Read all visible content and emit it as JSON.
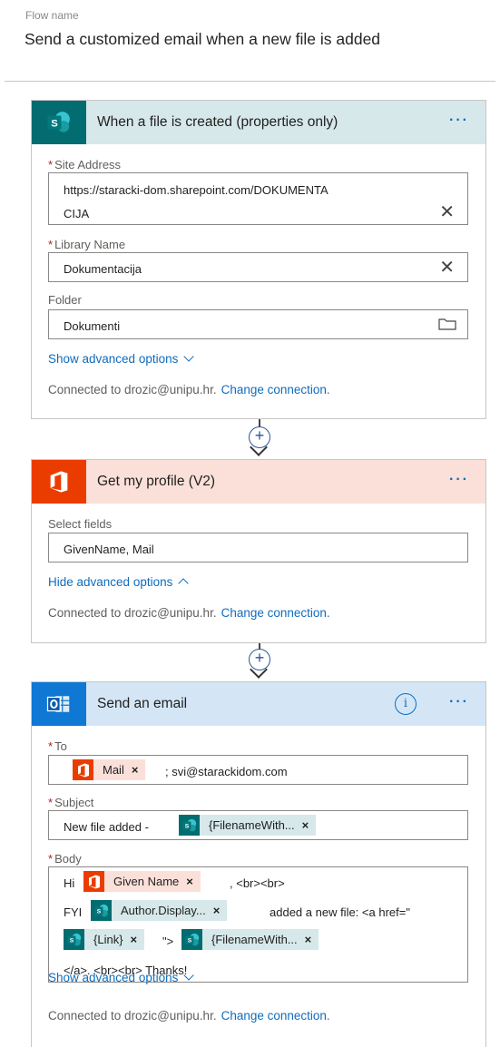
{
  "flow": {
    "name_label": "Flow name",
    "name": "Send a customized email when a new file is added"
  },
  "trigger": {
    "title": "When a file is created (properties only)",
    "more": "···",
    "site_address_label": "Site Address",
    "site_address_line1": "https://staracki-dom.sharepoint.com/DOKUMENTA",
    "site_address_line2": "CIJA",
    "library_label": "Library Name",
    "library_value": "Dokumentacija",
    "folder_label": "Folder",
    "folder_value": "Dokumenti",
    "show_advanced": "Show advanced options",
    "connected_to": "Connected to drozic@unipu.hr.",
    "change_connection": "Change connection."
  },
  "profile": {
    "title": "Get my profile (V2)",
    "more": "···",
    "select_fields_label": "Select fields",
    "select_fields_value": "GivenName, Mail",
    "hide_advanced": "Hide advanced options",
    "connected_to": "Connected to drozic@unipu.hr.",
    "change_connection": "Change connection."
  },
  "email": {
    "title": "Send an email",
    "info": "i",
    "more": "···",
    "to_label": "To",
    "to_token": "Mail",
    "to_rest": "; svi@starackidom.com",
    "subject_label": "Subject",
    "subject_prefix": "New file added -",
    "subject_token": "{FilenameWith...",
    "body_label": "Body",
    "body_hi": "Hi",
    "body_token_given": "Given Name",
    "body_br1": ", <br><br>",
    "body_fyi": "FYI",
    "body_token_author": "Author.Display...",
    "body_added": "added a new file: <a href=\"",
    "body_token_link": "{Link}",
    "body_quote": "\">",
    "body_token_filename": "{FilenameWith...",
    "body_end": "</a>. <br><br> Thanks!",
    "show_advanced": "Show advanced options",
    "connected_to": "Connected to drozic@unipu.hr.",
    "change_connection": "Change connection."
  },
  "token_remove": "×",
  "icons": {
    "sharepoint": "sharepoint-icon",
    "office": "office-icon",
    "outlook": "outlook-icon",
    "close": "close-icon",
    "folder": "folder-icon",
    "add_step": "plus-circle-icon",
    "arrow": "arrow-down-icon",
    "info": "info-icon",
    "more": "more-icon"
  },
  "colors": {
    "sharepoint": "#036c70",
    "office": "#eb3c00",
    "outlook": "#0f78d4",
    "link": "#0f6cbd",
    "required": "#a4262c"
  }
}
